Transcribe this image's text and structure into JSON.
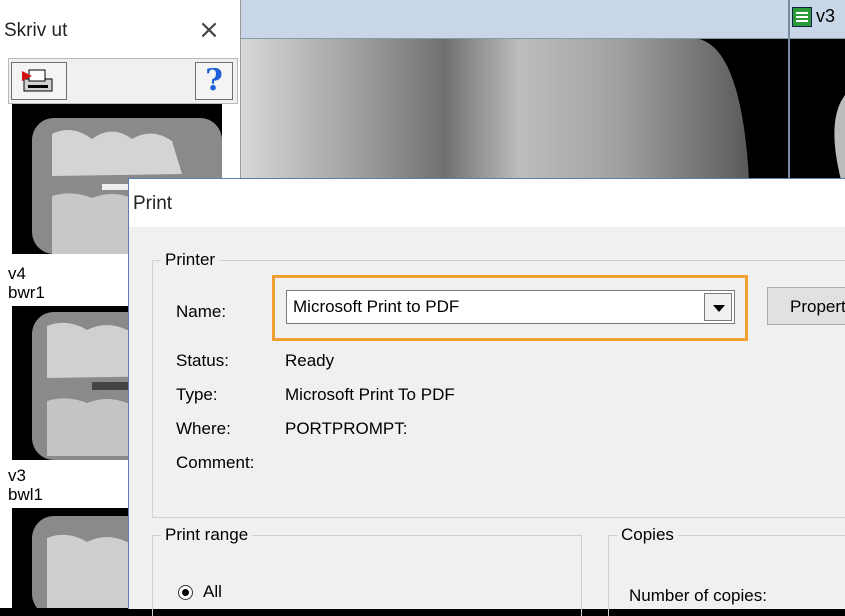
{
  "left_panel": {
    "title": "Skriv ut",
    "close_glyph": "×",
    "help_glyph": "?",
    "thumbnails": [
      {
        "label_line1": "",
        "label_line2": ""
      },
      {
        "label_line1": "v4",
        "label_line2": "bwr1"
      },
      {
        "label_line1": "v3",
        "label_line2": "bwl1"
      }
    ]
  },
  "image_view": {
    "tab_label": "v3"
  },
  "dialog": {
    "title": "Print",
    "printer_group": "Printer",
    "name_label": "Name:",
    "name_value": "Microsoft Print to PDF",
    "properties_label": "Properties...",
    "status_label": "Status:",
    "status_value": "Ready",
    "type_label": "Type:",
    "type_value": "Microsoft Print To PDF",
    "where_label": "Where:",
    "where_value": "PORTPROMPT:",
    "comment_label": "Comment:",
    "comment_value": "",
    "print_range_group": "Print range",
    "range_all_label": "All",
    "copies_group": "Copies",
    "copies_label": "Number of copies:"
  },
  "colors": {
    "highlight": "#f0a030",
    "dialog_bg": "#f0f0f0"
  }
}
